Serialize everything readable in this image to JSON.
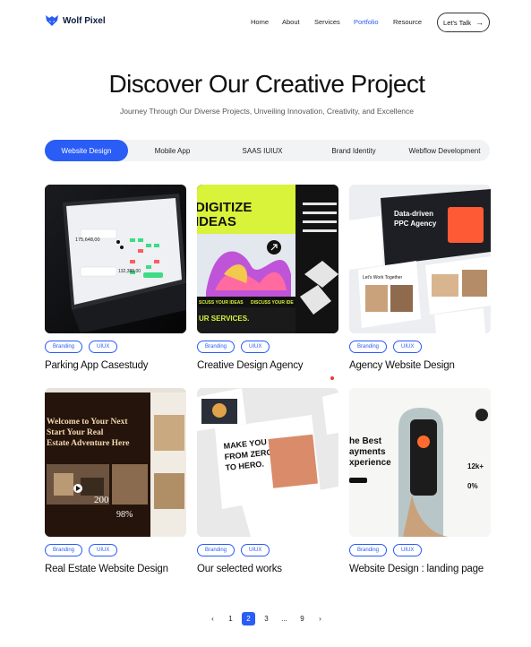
{
  "header": {
    "logo_text": "Wolf Pixel",
    "nav": [
      {
        "label": "Home"
      },
      {
        "label": "About"
      },
      {
        "label": "Services"
      },
      {
        "label": "Portfolio",
        "active": true
      },
      {
        "label": "Resource"
      }
    ],
    "cta_label": "Let's Talk",
    "accent_color": "#2a5cf6"
  },
  "hero": {
    "title": "Discover Our Creative Project",
    "subtitle": "Journey Through Our Diverse Projects, Unveiling Innovation, Creativity, and Excellence"
  },
  "tabs": [
    {
      "label": "Website Design",
      "active": true
    },
    {
      "label": "Mobile App"
    },
    {
      "label": "SAAS IUIUX"
    },
    {
      "label": "Brand Identity"
    },
    {
      "label": "Webflow Development"
    }
  ],
  "projects": [
    {
      "title": "Parking App Casestudy",
      "tags": [
        "Branding",
        "UIUX"
      ],
      "thumb_text": [
        "175,648,00",
        "132,388,00"
      ]
    },
    {
      "title": "Creative Design Agency",
      "tags": [
        "Branding",
        "UIUX"
      ],
      "thumb_text": [
        "DIGITIZE",
        "IDEAS",
        "SCUSS YOUR IDEAS",
        "DISCUSS YOUR IDE",
        "UR SERVICES."
      ]
    },
    {
      "title": "Agency Website Design",
      "tags": [
        "Branding",
        "UIUX"
      ],
      "thumb_text": [
        "Data-driven",
        "PPC Agency",
        "Let's Work Together"
      ]
    },
    {
      "title": "Real Estate Website Design",
      "tags": [
        "Branding",
        "UIUX"
      ],
      "thumb_text": [
        "Welcome to Your Next",
        "Start Your Real",
        "Estate Adventure Here",
        "200",
        "98%"
      ]
    },
    {
      "title": "Our selected works",
      "tags": [
        "Branding",
        "UIUX"
      ],
      "thumb_text": [
        "MAKE YOU",
        "FROM ZERO",
        "TO HERO."
      ]
    },
    {
      "title": "Website Design : landing page",
      "tags": [
        "Branding",
        "UIUX"
      ],
      "thumb_text": [
        "he Best",
        "ayments",
        "xperience",
        "12k+",
        "0%"
      ]
    }
  ],
  "pagination": {
    "prev": "‹",
    "pages": [
      "1",
      "2",
      "3",
      "...",
      "9"
    ],
    "current": "2",
    "next": "›"
  }
}
